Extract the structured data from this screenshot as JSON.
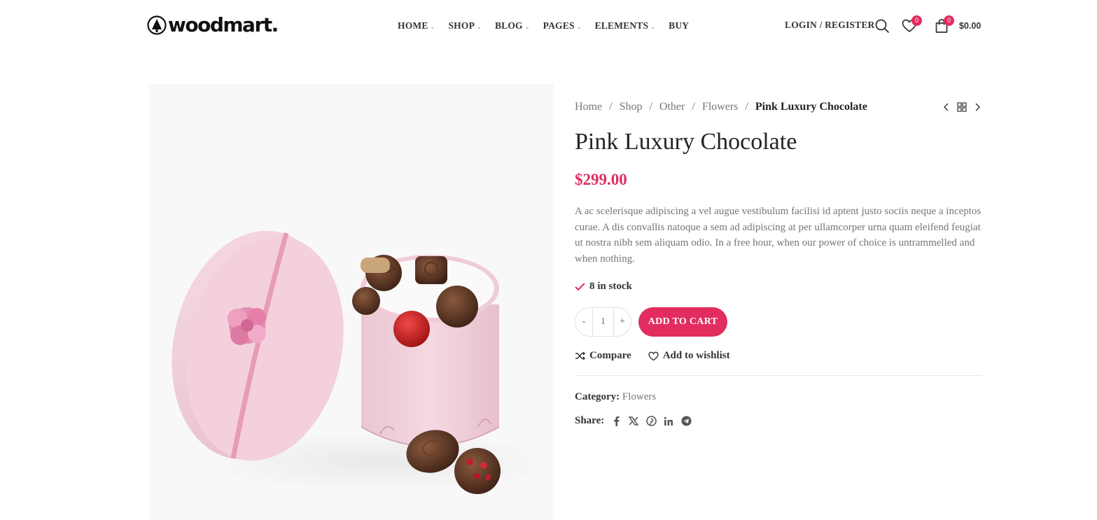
{
  "header": {
    "logo_text": "woodmart.",
    "nav": [
      {
        "label": "HOME",
        "has_dropdown": true
      },
      {
        "label": "SHOP",
        "has_dropdown": true
      },
      {
        "label": "BLOG",
        "has_dropdown": true
      },
      {
        "label": "PAGES",
        "has_dropdown": true
      },
      {
        "label": "ELEMENTS",
        "has_dropdown": true
      },
      {
        "label": "BUY",
        "has_dropdown": false
      }
    ],
    "login_label": "LOGIN / REGISTER",
    "wishlist_count": "0",
    "cart_count": "0",
    "cart_total": "$0.00"
  },
  "breadcrumb": {
    "items": [
      "Home",
      "Shop",
      "Other",
      "Flowers"
    ],
    "current": "Pink Luxury Chocolate",
    "separator": "/"
  },
  "product": {
    "title": "Pink Luxury Chocolate",
    "price": "$299.00",
    "description": "A ac scelerisque adipiscing a vel augue vestibulum facilisi id aptent justo sociis neque a inceptos curae. A dis convallis natoque a sem ad adipiscing at per ullamcorper urna quam eleifend feugiat ut nostra nibh sem aliquam odio. In a free hour, when our power of choice is untrammelled and when nothing.",
    "stock": "8 in stock",
    "quantity": "1",
    "qty_minus": "-",
    "qty_plus": "+",
    "add_to_cart_label": "ADD TO CART",
    "compare_label": "Compare",
    "wishlist_label": "Add to wishlist",
    "category_label": "Category:",
    "category_value": "Flowers",
    "share_label": "Share:",
    "share_icons": [
      "facebook-icon",
      "x-twitter-icon",
      "pinterest-icon",
      "linkedin-icon",
      "telegram-icon"
    ]
  },
  "colors": {
    "accent": "#e22d5e",
    "text": "#242424",
    "muted": "#777777"
  }
}
